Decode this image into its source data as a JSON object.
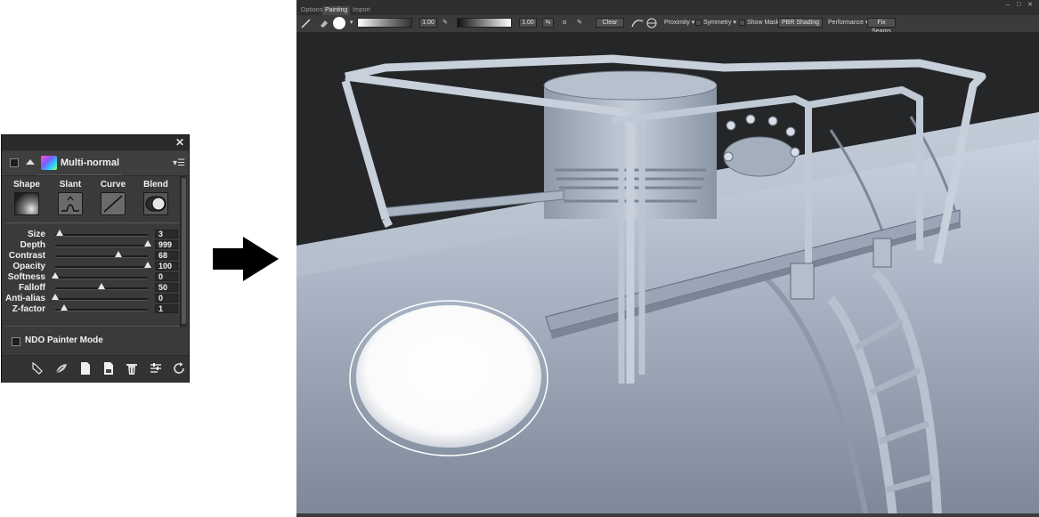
{
  "panel": {
    "title": "Multi-normal",
    "close_glyph": "✕",
    "menu_glyph": "▾☰",
    "shape_labels": [
      "Shape",
      "Slant",
      "Curve",
      "Blend"
    ],
    "sliders": [
      {
        "label": "Size",
        "value": "3",
        "fraction": 0.05
      },
      {
        "label": "Depth",
        "value": "999",
        "fraction": 1.0
      },
      {
        "label": "Contrast",
        "value": "68",
        "fraction": 0.68
      },
      {
        "label": "Opacity",
        "value": "100",
        "fraction": 1.0
      },
      {
        "label": "Softness",
        "value": "0",
        "fraction": 0.0
      },
      {
        "label": "Falloff",
        "value": "50",
        "fraction": 0.5
      },
      {
        "label": "Anti-alias",
        "value": "0",
        "fraction": 0.0
      },
      {
        "label": "Z-factor",
        "value": "1",
        "fraction": 0.1
      }
    ],
    "ndo_label": "NDO Painter Mode",
    "footer_icons": [
      "pen-tool-icon",
      "brush-leaf-icon",
      "new-document-icon",
      "save-document-icon",
      "trash-icon",
      "settings-sliders-icon",
      "refresh-icon"
    ]
  },
  "viewport": {
    "tabs": [
      "Options",
      "Painting",
      "Import"
    ],
    "active_tab": "Painting",
    "win_controls": "– □ ✕",
    "toolbar": {
      "brush_opacity": "1.00",
      "gradient_value": "1.00",
      "clear_label": "Clear",
      "proximity_label": "Proximity ▾",
      "symmetry_label": "Symmetry ▾",
      "show_mask_label": "Show Mask",
      "shading_label": "PBR Shading",
      "performance_label": "Performance ▾",
      "fix_seams_label": "Fix Seams"
    }
  },
  "colors": {
    "panel_bg": "#3a3a3a",
    "viewport_bg": "#2a2a2a",
    "model_base": "#aab6c6",
    "model_shadow": "#6b7686",
    "brush_cursor": "#ffffff"
  }
}
